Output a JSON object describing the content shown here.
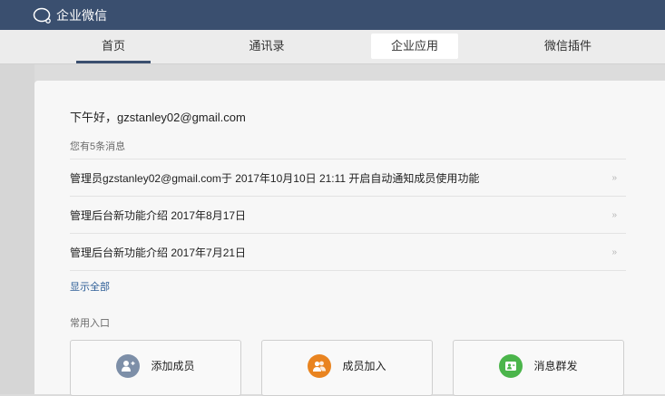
{
  "app": {
    "brand": "企业微信"
  },
  "nav": {
    "tabs": [
      {
        "label": "首页"
      },
      {
        "label": "通讯录"
      },
      {
        "label": "企业应用"
      },
      {
        "label": "微信插件"
      }
    ]
  },
  "home": {
    "greeting": "下午好，gzstanley02@gmail.com",
    "message_count": "您有5条消息",
    "messages": [
      {
        "text": "管理员gzstanley02@gmail.com于 2017年10月10日 21:11 开启自动通知成员使用功能",
        "more": "»"
      },
      {
        "text": "管理后台新功能介绍 2017年8月17日",
        "more": "»"
      },
      {
        "text": "管理后台新功能介绍 2017年7月21日",
        "more": "»"
      }
    ],
    "show_all": "显示全部",
    "quick_title": "常用入口",
    "quick_entries": [
      {
        "label": "添加成员",
        "icon": "add-member-icon",
        "color": "#7d8fa8"
      },
      {
        "label": "成员加入",
        "icon": "members-join-icon",
        "color": "#e98420"
      },
      {
        "label": "消息群发",
        "icon": "broadcast-icon",
        "color": "#4bb54b"
      }
    ]
  }
}
